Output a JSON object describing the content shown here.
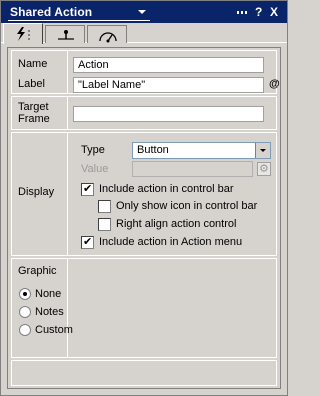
{
  "window": {
    "title": "Shared Action",
    "controls": {
      "minimize": "▪▪▪",
      "help": "?",
      "close": "X"
    }
  },
  "tabs": [
    {
      "name": "action-tab",
      "icon": "lightning-icon",
      "active": true
    },
    {
      "name": "event-tab",
      "icon": "pin-icon",
      "active": false
    },
    {
      "name": "appearance-tab",
      "icon": "gauge-icon",
      "active": false
    }
  ],
  "general": {
    "name_label": "Name",
    "name_value": "Action",
    "label_label": "Label",
    "label_value": "\"Label Name\"",
    "label_at": "@"
  },
  "target": {
    "label": "Target Frame",
    "label_line1": "Target",
    "label_line2": "Frame",
    "value": ""
  },
  "display": {
    "label": "Display",
    "type_label": "Type",
    "type_value": "Button",
    "value_label": "Value",
    "value_value": "",
    "options": [
      {
        "label": "Include action in control bar",
        "checked": true
      },
      {
        "label": "Only show icon in control bar",
        "checked": false
      },
      {
        "label": "Right align action control",
        "checked": false
      },
      {
        "label": "Include action in Action menu",
        "checked": true
      }
    ]
  },
  "graphic": {
    "label": "Graphic",
    "options": [
      {
        "label": "None",
        "checked": true
      },
      {
        "label": "Notes",
        "checked": false
      },
      {
        "label": "Custom",
        "checked": false
      }
    ]
  }
}
